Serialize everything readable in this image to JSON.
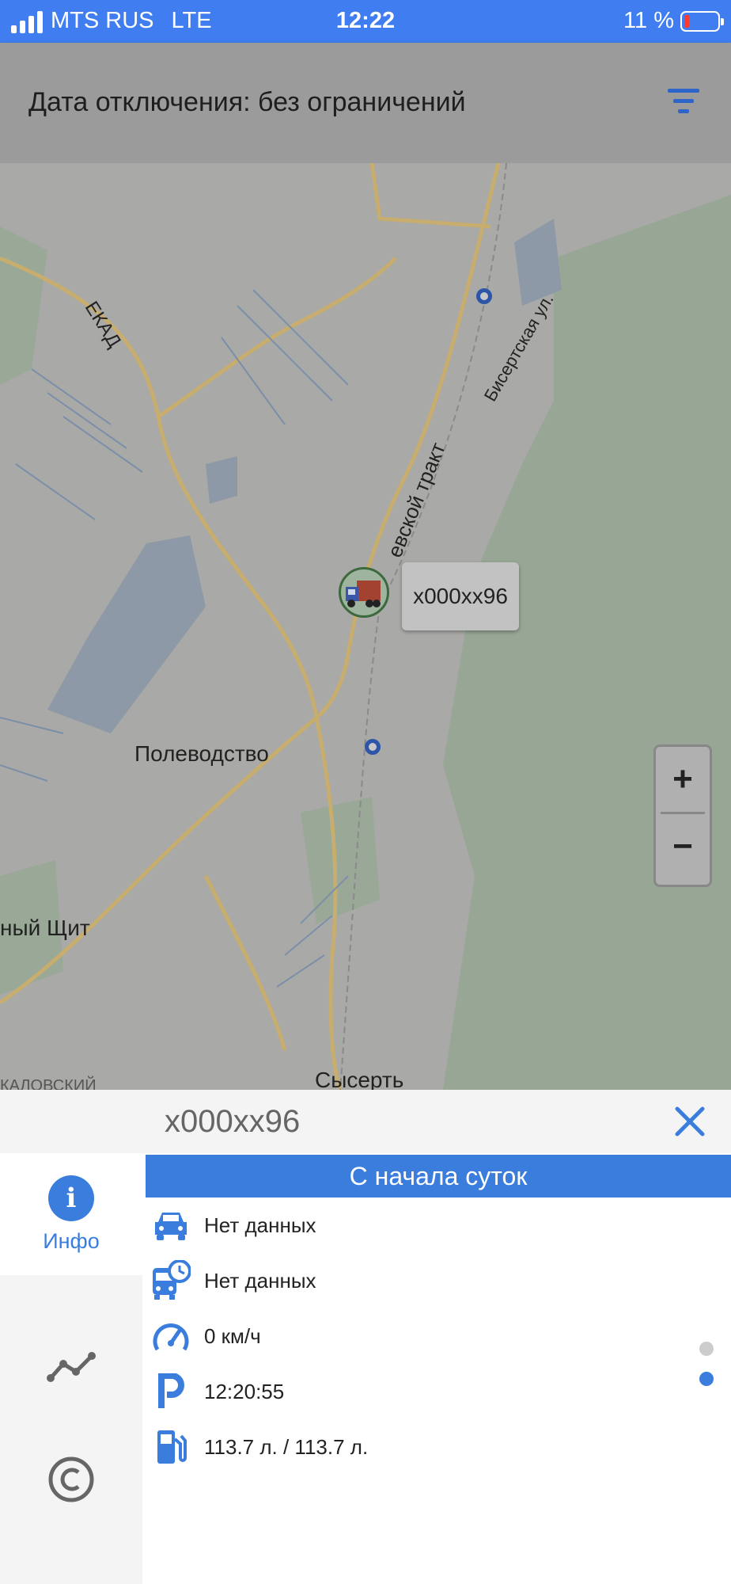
{
  "status_bar": {
    "carrier": "MTS RUS",
    "network": "LTE",
    "time": "12:22",
    "battery": "11 %"
  },
  "header": {
    "title": "Дата отключения: без ограничений",
    "filter_icon": "filter-icon"
  },
  "map": {
    "labels": {
      "ekad": "ЕКАД",
      "bisertskaya": "Бисертская ул.",
      "trakt": "евской тракт",
      "polevodstvo": "Полеводство",
      "shchit": "ный Щит",
      "sysert": "Сысерть",
      "kalinovsky": "КАЛОВСКИЙ"
    },
    "vehicle_label": "х000хх96",
    "zoom_in": "+",
    "zoom_out": "−"
  },
  "panel": {
    "vehicle_name": "х000хх96",
    "close_icon": "close-icon",
    "nav": [
      {
        "icon": "info-icon",
        "label": "Инфо",
        "active": true
      },
      {
        "icon": "track-chart-icon",
        "label": "",
        "active": false
      },
      {
        "icon": "copyright-icon",
        "label": "",
        "active": false
      }
    ],
    "section_title": "С начала суток",
    "rows": [
      {
        "icon": "car-icon",
        "text": "Нет данных"
      },
      {
        "icon": "bus-clock-icon",
        "text": "Нет данных"
      },
      {
        "icon": "speedometer-icon",
        "text": "0 км/ч"
      },
      {
        "icon": "parking-icon",
        "text": "12:20:55"
      },
      {
        "icon": "fuel-icon",
        "text": "113.7 л. / 113.7 л."
      }
    ],
    "accent_color": "#3a7ddc"
  }
}
